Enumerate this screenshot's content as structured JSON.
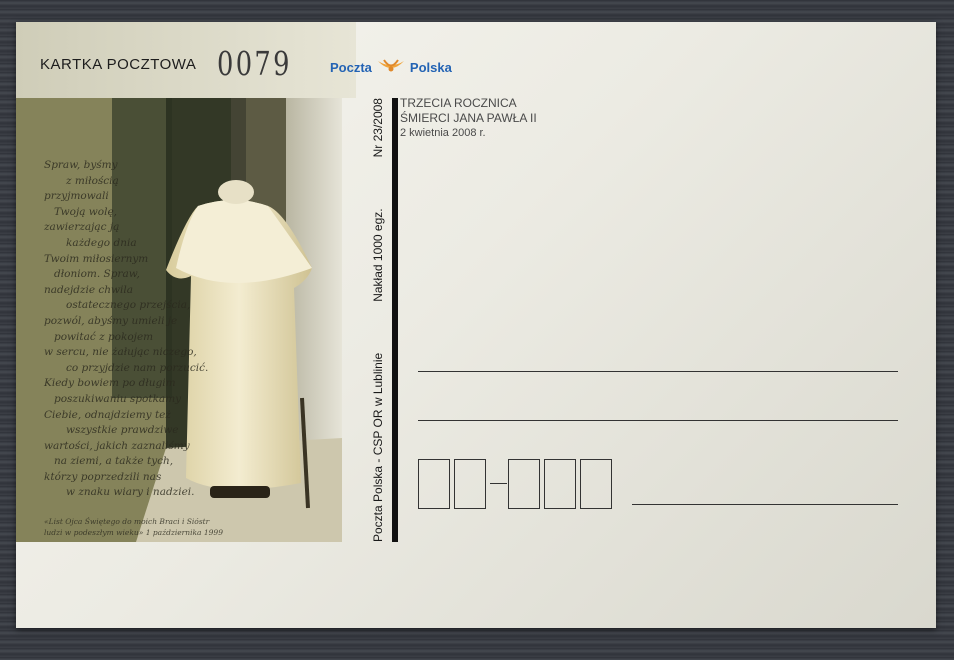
{
  "card": {
    "title": "KARTKA POCZTOWA",
    "serial_number": "0079",
    "brand": "Poczta",
    "brand_second": "Polska",
    "brand_color": "#2363b4",
    "horn_color": "#f1a43b",
    "horn_icon": "post-horn-icon"
  },
  "issue": {
    "title_line1": "TRZECIA ROCZNICA",
    "title_line2": "ŚMIERCI JANA PAWŁA II",
    "date": "2 kwietnia 2008 r."
  },
  "vertical_strip": {
    "publisher": "Poczta Polska - CSP OR w Lublinie",
    "edition": "Nakład 1000 egz.",
    "number": "Nr 23/2008"
  },
  "photo": {
    "poem_lines": [
      "Spraw, byśmy",
      "z miłością",
      "przyjmowali",
      "Twoją wolę,",
      "zawierzając ją",
      "każdego dnia",
      "Twoim miłosiernym",
      "dłoniom. Spraw,",
      "nadejdzie chwila",
      "ostatecznego przejścia,",
      "pozwól, abyśmy umieli je",
      "powitać z pokojem",
      "w sercu, nie żałując niczego,",
      "co przyjdzie nam porzucić.",
      "Kiedy bowiem po długim",
      "poszukiwaniu spotkamy",
      "Ciebie, odnajdziemy też",
      "wszystkie prawdziwe",
      "wartości, jakich zaznaliśmy",
      "na ziemi, a także tych,",
      "którzy poprzedzili nas",
      "w znaku wiary i nadziei."
    ],
    "caption_line1": "«List Ojca Świętego do moich Braci i Sióstr",
    "caption_line2": "ludzi w podeszłym wieku» 1 października 1999"
  },
  "address": {
    "zip_box_count": 5
  }
}
